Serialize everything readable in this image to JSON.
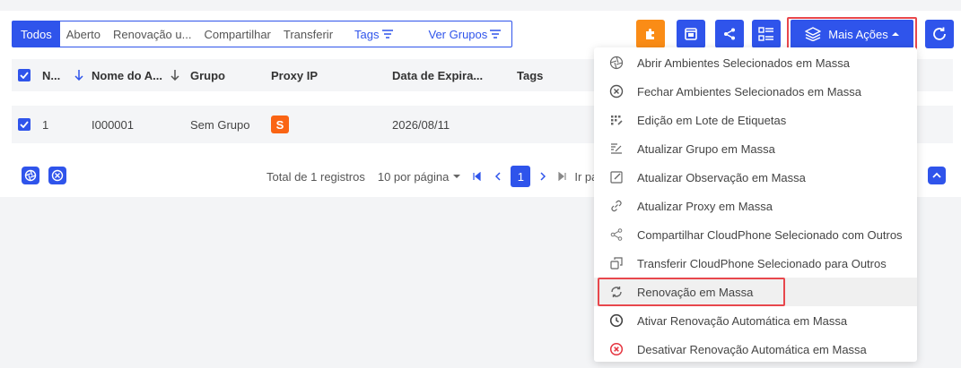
{
  "filters": [
    {
      "label": "Todos",
      "active": true
    },
    {
      "label": "Aberto"
    },
    {
      "label": "Renovação u..."
    },
    {
      "label": "Compartilhar"
    },
    {
      "label": "Transferir"
    },
    {
      "label": "Tags",
      "blue": true
    },
    {
      "label": "Ver Grupos",
      "blue": true
    }
  ],
  "toolbar": {
    "more_actions_label": "Mais Ações",
    "accent": "#2f54eb",
    "orange": "#fa8c16",
    "highlight": "#e8474c"
  },
  "table": {
    "headers": {
      "no": "N...",
      "name": "Nome do A...",
      "group": "Grupo",
      "proxy": "Proxy IP",
      "expiry": "Data de Expira...",
      "tags": "Tags"
    },
    "rows": [
      {
        "no": "1",
        "name": "I000001",
        "group": "Sem Grupo",
        "proxy_badge": "S",
        "expiry": "2026/08/11",
        "tags": ""
      }
    ]
  },
  "pagination": {
    "total": "Total de 1 registros",
    "per_page": "10 por página",
    "current_page": "1",
    "goto": "Ir par"
  },
  "menu": [
    {
      "icon": "aperture-icon",
      "label": "Abrir Ambientes Selecionados em Massa"
    },
    {
      "icon": "close-circle-icon",
      "label": "Fechar Ambientes Selecionados em Massa"
    },
    {
      "icon": "tag-grid-icon",
      "label": "Edição em Lote de Etiquetas"
    },
    {
      "icon": "group-edit-icon",
      "label": "Atualizar Grupo em Massa"
    },
    {
      "icon": "note-edit-icon",
      "label": "Atualizar Observação em Massa"
    },
    {
      "icon": "link-icon",
      "label": "Atualizar Proxy em Massa"
    },
    {
      "icon": "share-icon",
      "label": "Compartilhar CloudPhone Selecionado com Outros"
    },
    {
      "icon": "transfer-icon",
      "label": "Transferir CloudPhone Selecionado para Outros"
    },
    {
      "icon": "refresh-icon",
      "label": "Renovação em Massa"
    },
    {
      "icon": "clock-icon",
      "label": "Ativar Renovação Automática em Massa"
    },
    {
      "icon": "close-circle-red-icon",
      "label": "Desativar Renovação Automática em Massa"
    }
  ]
}
